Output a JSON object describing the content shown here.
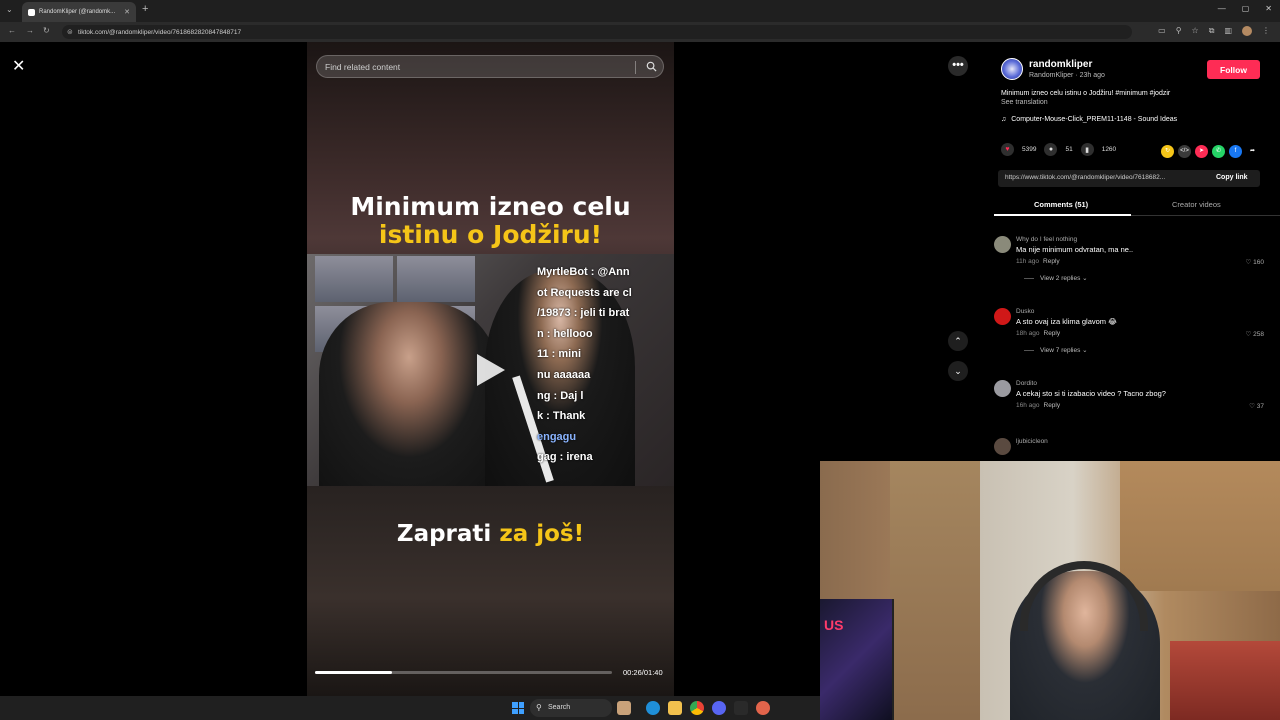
{
  "browser": {
    "tab_title": "RandomKliper (@randomk...",
    "url": "tiktok.com/@randomkliper/video/7618682820847848717"
  },
  "search": {
    "placeholder": "Find related content"
  },
  "video": {
    "title_line1": "Minimum izneo celu",
    "title_line2": "istinu o Jodžiru!",
    "chat_lines": [
      "MyrtleBot : @Ann",
      "ot Requests are cl",
      "/19873 : jeli ti brat",
      "n : hellooo",
      "11 : mini",
      "nu aaaaaa",
      "ng : Daj l",
      "k : Thank",
      "engagu",
      "gag : irena"
    ],
    "cta_white": "Zaprati",
    "cta_yellow": "za još!",
    "time": "00:26/01:40",
    "progress": 0.26
  },
  "author": {
    "name": "randomkliper",
    "sub": "RandomKliper · 23h ago",
    "follow_label": "Follow",
    "description": "Minimum izneo celu istinu o Jodžiru! #minimum #jodzir",
    "see_translation": "See translation",
    "music": "Computer-Mouse-Click_PREM11-1148 - Sound Ideas"
  },
  "stats": {
    "likes": "5399",
    "comments": "51",
    "saves": "1260"
  },
  "link": {
    "url": "https://www.tiktok.com/@randomkliper/video/7618682...",
    "copy_label": "Copy link"
  },
  "tabs": {
    "comments": "Comments (51)",
    "creator": "Creator videos"
  },
  "comments": [
    {
      "user": "Why do I feel nothing",
      "text": "Ma nije minimum odvratan, ma ne..",
      "time": "11h ago",
      "reply": "Reply",
      "likes": "160",
      "replies": "View 2 replies",
      "avatar_color": "#8a8a7a"
    },
    {
      "user": "Dusko",
      "text": "A sto ovaj iza klima glavom 😂",
      "time": "18h ago",
      "reply": "Reply",
      "likes": "258",
      "replies": "View 7 replies",
      "avatar_color": "#d01818"
    },
    {
      "user": "Dordito",
      "text": "A cekaj sto si ti izabacio video ? Tacno zbog?",
      "time": "16h ago",
      "reply": "Reply",
      "likes": "37",
      "replies": "",
      "avatar_color": "#9a9aa0"
    },
    {
      "user": "ljubicicleon",
      "text": "",
      "time": "",
      "reply": "",
      "likes": "",
      "replies": "",
      "avatar_color": "#5a4a40"
    }
  ],
  "webcam": {
    "pc_text": "US"
  },
  "taskbar": {
    "search": "Search"
  }
}
